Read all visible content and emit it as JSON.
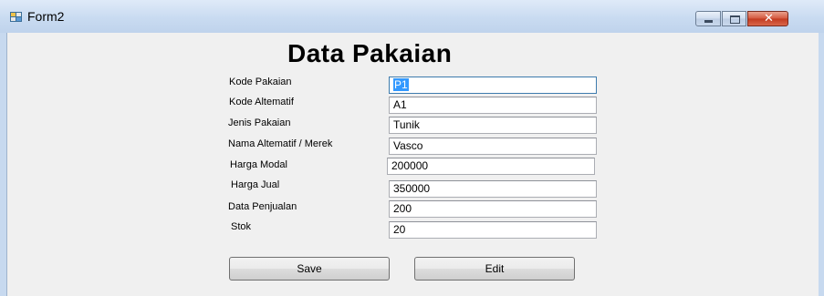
{
  "window": {
    "title": "Form2",
    "controls": [
      "minimize",
      "maximize",
      "close"
    ]
  },
  "form": {
    "heading": "Data Pakaian",
    "fields": [
      {
        "label": "Kode Pakaian",
        "value": "P1"
      },
      {
        "label": "Kode Altematif",
        "value": "A1"
      },
      {
        "label": "Jenis Pakaian",
        "value": "Tunik"
      },
      {
        "label": "Nama Altematif / Merek",
        "value": "Vasco"
      },
      {
        "label": "Harga Modal",
        "value": "200000"
      },
      {
        "label": "Harga Jual",
        "value": "350000"
      },
      {
        "label": "Data Penjualan",
        "value": "200"
      },
      {
        "label": "Stok",
        "value": "20"
      }
    ],
    "buttons": {
      "save": "Save",
      "edit": "Edit"
    }
  },
  "icons": {
    "app": "form-window-icon",
    "close": "close-icon",
    "minimize": "minimize-icon",
    "maximize": "maximize-icon"
  }
}
